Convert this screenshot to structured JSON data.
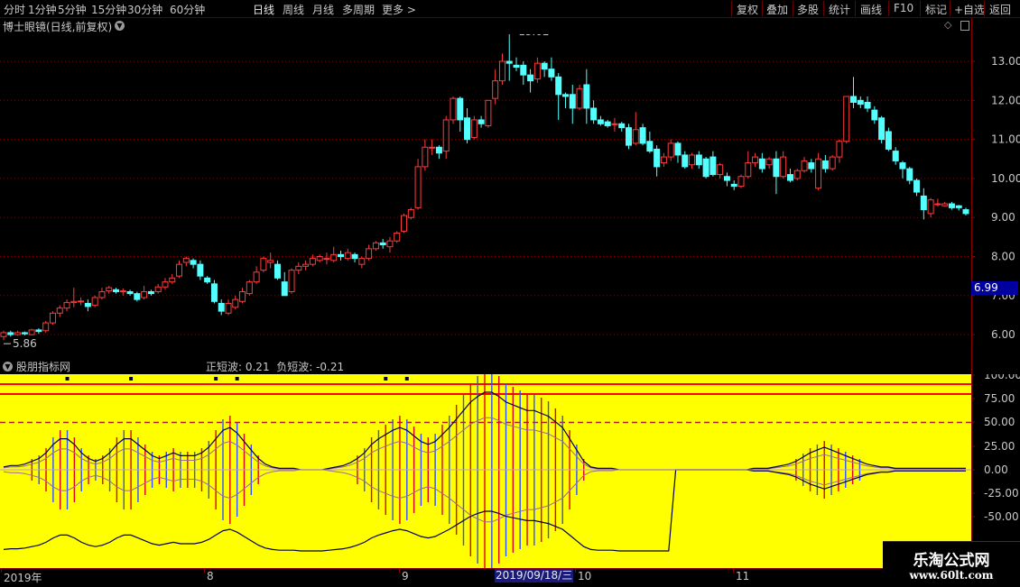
{
  "toolbar": {
    "left_items": [
      "分时",
      "1分钟",
      "5分钟",
      "15分钟",
      "30分钟",
      "60分钟",
      "日线",
      "周线",
      "月线",
      "多周期",
      "更多 >"
    ],
    "active": "日线",
    "right_items": [
      "复权",
      "叠加",
      "多股",
      "统计",
      "画线",
      "F10",
      "标记",
      "+自选",
      "返回"
    ]
  },
  "main_chart": {
    "title": "博士眼镜(日线,前复权)",
    "high_label": "13.62",
    "low_label": "5.86",
    "price_ticks": [
      "13.00",
      "12.00",
      "11.00",
      "10.00",
      "9.00",
      "8.00",
      "7.00",
      "6.00"
    ],
    "current_price": "6.99",
    "colors": {
      "up": "#ff3c3c",
      "down": "#54ffff",
      "grid": "#8b0000"
    },
    "candles": [
      [
        5.95,
        6.05,
        5.86,
        6.1
      ],
      [
        6.05,
        6.0,
        5.95,
        6.1
      ],
      [
        6.0,
        6.05,
        5.97,
        6.1
      ],
      [
        6.05,
        6.02,
        5.98,
        6.08
      ],
      [
        6.0,
        6.12,
        5.98,
        6.15
      ],
      [
        6.12,
        6.08,
        6.02,
        6.16
      ],
      [
        6.1,
        6.3,
        6.05,
        6.35
      ],
      [
        6.3,
        6.55,
        6.25,
        6.6
      ],
      [
        6.55,
        6.68,
        6.45,
        6.75
      ],
      [
        6.68,
        6.82,
        6.6,
        6.9
      ],
      [
        6.82,
        6.85,
        6.7,
        7.2
      ],
      [
        6.85,
        6.86,
        6.75,
        6.95
      ],
      [
        6.8,
        6.72,
        6.6,
        6.9
      ],
      [
        6.75,
        6.95,
        6.7,
        7.0
      ],
      [
        6.95,
        7.1,
        6.9,
        7.2
      ],
      [
        7.12,
        7.2,
        7.05,
        7.25
      ],
      [
        7.15,
        7.1,
        7.05,
        7.2
      ],
      [
        7.1,
        7.12,
        7.0,
        7.18
      ],
      [
        7.1,
        7.05,
        7.0,
        7.15
      ],
      [
        7.05,
        6.9,
        6.85,
        7.1
      ],
      [
        6.95,
        7.1,
        6.9,
        7.25
      ],
      [
        7.1,
        7.05,
        7.0,
        7.15
      ],
      [
        7.1,
        7.22,
        7.05,
        7.3
      ],
      [
        7.22,
        7.35,
        7.15,
        7.45
      ],
      [
        7.35,
        7.45,
        7.3,
        7.55
      ],
      [
        7.5,
        7.8,
        7.45,
        7.9
      ],
      [
        7.85,
        7.95,
        7.75,
        8.0
      ],
      [
        7.9,
        7.8,
        7.7,
        7.95
      ],
      [
        7.8,
        7.5,
        7.4,
        7.9
      ],
      [
        7.45,
        7.35,
        7.3,
        7.5
      ],
      [
        7.3,
        6.85,
        6.8,
        7.4
      ],
      [
        6.8,
        6.6,
        6.5,
        6.9
      ],
      [
        6.55,
        6.8,
        6.5,
        6.9
      ],
      [
        6.7,
        6.9,
        6.65,
        7.0
      ],
      [
        6.85,
        7.1,
        6.8,
        7.2
      ],
      [
        7.05,
        7.35,
        7.0,
        7.4
      ],
      [
        7.35,
        7.6,
        7.3,
        7.75
      ],
      [
        7.65,
        7.95,
        7.6,
        8.0
      ],
      [
        7.85,
        7.9,
        7.7,
        8.1
      ],
      [
        7.8,
        7.45,
        7.4,
        7.9
      ],
      [
        7.35,
        7.0,
        7.0,
        7.6
      ],
      [
        7.1,
        7.65,
        7.05,
        7.7
      ],
      [
        7.65,
        7.75,
        7.55,
        7.85
      ],
      [
        7.75,
        7.8,
        7.65,
        7.9
      ],
      [
        7.8,
        7.95,
        7.75,
        8.05
      ],
      [
        7.9,
        8.0,
        7.85,
        8.05
      ],
      [
        7.95,
        7.95,
        7.8,
        8.1
      ],
      [
        7.9,
        8.05,
        7.85,
        8.25
      ],
      [
        8.05,
        8.0,
        7.9,
        8.15
      ],
      [
        7.95,
        8.1,
        7.9,
        8.2
      ],
      [
        8.05,
        7.95,
        7.85,
        8.1
      ],
      [
        7.8,
        7.95,
        7.7,
        8.0
      ],
      [
        7.95,
        8.2,
        7.9,
        8.3
      ],
      [
        8.2,
        8.35,
        8.15,
        8.4
      ],
      [
        8.35,
        8.3,
        8.2,
        8.45
      ],
      [
        8.25,
        8.4,
        8.1,
        8.5
      ],
      [
        8.4,
        8.6,
        8.35,
        8.65
      ],
      [
        8.65,
        9.05,
        8.6,
        9.1
      ],
      [
        9.0,
        9.2,
        8.95,
        9.25
      ],
      [
        9.25,
        10.3,
        9.2,
        10.5
      ],
      [
        10.3,
        10.8,
        10.2,
        11.0
      ],
      [
        10.8,
        10.8,
        10.6,
        11.0
      ],
      [
        10.8,
        10.65,
        10.5,
        10.85
      ],
      [
        10.7,
        11.5,
        10.5,
        11.6
      ],
      [
        11.5,
        12.05,
        11.4,
        12.1
      ],
      [
        12.05,
        11.5,
        11.2,
        12.1
      ],
      [
        11.55,
        11.0,
        10.9,
        11.8
      ],
      [
        11.05,
        11.5,
        11.0,
        11.6
      ],
      [
        11.5,
        11.4,
        11.3,
        11.6
      ],
      [
        11.35,
        12.0,
        11.3,
        12.0
      ],
      [
        12.05,
        12.5,
        11.9,
        12.8
      ],
      [
        12.5,
        13.0,
        12.4,
        13.2
      ],
      [
        13.0,
        12.95,
        12.5,
        13.62
      ],
      [
        12.9,
        12.85,
        12.75,
        13.1
      ],
      [
        12.9,
        12.65,
        12.4,
        13.0
      ],
      [
        12.65,
        12.5,
        12.2,
        12.8
      ],
      [
        12.55,
        12.95,
        12.45,
        13.1
      ],
      [
        12.95,
        12.8,
        12.6,
        13.0
      ],
      [
        12.8,
        12.6,
        12.5,
        13.1
      ],
      [
        12.6,
        12.15,
        11.5,
        12.7
      ],
      [
        12.15,
        12.1,
        11.8,
        12.2
      ],
      [
        12.15,
        11.8,
        11.4,
        12.4
      ],
      [
        11.8,
        12.3,
        11.75,
        12.4
      ],
      [
        12.4,
        11.8,
        11.4,
        12.8
      ],
      [
        11.8,
        11.5,
        11.4,
        12.0
      ],
      [
        11.5,
        11.4,
        11.35,
        11.6
      ],
      [
        11.45,
        11.35,
        11.3,
        11.5
      ],
      [
        11.4,
        11.4,
        11.2,
        11.55
      ],
      [
        11.4,
        11.3,
        11.2,
        11.45
      ],
      [
        11.3,
        10.85,
        10.75,
        11.4
      ],
      [
        10.9,
        11.25,
        10.85,
        11.7
      ],
      [
        11.3,
        10.9,
        10.85,
        11.4
      ],
      [
        10.95,
        10.7,
        10.65,
        11.2
      ],
      [
        10.75,
        10.3,
        10.05,
        10.85
      ],
      [
        10.4,
        10.55,
        10.3,
        10.65
      ],
      [
        10.55,
        10.9,
        10.45,
        11.0
      ],
      [
        10.9,
        10.6,
        10.4,
        10.95
      ],
      [
        10.6,
        10.3,
        10.25,
        10.7
      ],
      [
        10.35,
        10.6,
        10.25,
        10.65
      ],
      [
        10.6,
        10.35,
        10.25,
        10.7
      ],
      [
        10.5,
        10.05,
        10.0,
        10.55
      ],
      [
        10.55,
        10.1,
        10.05,
        10.7
      ],
      [
        10.1,
        10.35,
        10.0,
        10.4
      ],
      [
        10.05,
        9.95,
        9.8,
        10.15
      ],
      [
        9.85,
        9.8,
        9.7,
        9.95
      ],
      [
        9.8,
        10.05,
        9.75,
        10.1
      ],
      [
        10.05,
        10.4,
        10.0,
        10.7
      ],
      [
        10.4,
        10.55,
        10.3,
        10.65
      ],
      [
        10.5,
        10.25,
        10.15,
        10.65
      ],
      [
        10.35,
        10.5,
        10.25,
        10.55
      ],
      [
        10.5,
        10.05,
        9.6,
        10.7
      ],
      [
        10.05,
        10.55,
        10.0,
        10.7
      ],
      [
        10.1,
        9.95,
        9.9,
        10.25
      ],
      [
        10.0,
        10.2,
        9.95,
        10.25
      ],
      [
        10.2,
        10.45,
        10.15,
        10.55
      ],
      [
        10.4,
        10.25,
        10.15,
        10.5
      ],
      [
        9.75,
        10.5,
        9.7,
        10.65
      ],
      [
        10.45,
        10.25,
        10.15,
        10.6
      ],
      [
        10.25,
        10.55,
        10.2,
        10.6
      ],
      [
        10.55,
        10.95,
        10.4,
        11.0
      ],
      [
        10.95,
        12.1,
        10.9,
        12.1
      ],
      [
        12.1,
        11.95,
        11.8,
        12.6
      ],
      [
        12.0,
        11.9,
        11.8,
        12.1
      ],
      [
        11.95,
        11.8,
        11.7,
        12.1
      ],
      [
        11.75,
        11.5,
        11.4,
        11.85
      ],
      [
        11.55,
        11.0,
        10.9,
        11.6
      ],
      [
        11.2,
        10.75,
        10.7,
        11.3
      ],
      [
        10.7,
        10.45,
        10.35,
        10.8
      ],
      [
        10.4,
        10.25,
        10.0,
        10.45
      ],
      [
        10.25,
        9.95,
        9.85,
        10.3
      ],
      [
        9.95,
        9.65,
        9.55,
        10.0
      ],
      [
        9.55,
        9.2,
        8.95,
        9.75
      ],
      [
        9.1,
        9.45,
        9.0,
        9.5
      ],
      [
        9.35,
        9.35,
        9.28,
        9.48
      ],
      [
        9.3,
        9.35,
        9.28,
        9.4
      ],
      [
        9.35,
        9.25,
        9.2,
        9.4
      ],
      [
        9.3,
        9.25,
        9.18,
        9.32
      ],
      [
        9.2,
        9.1,
        9.05,
        9.25
      ]
    ]
  },
  "indicator": {
    "name": "股朋指标网",
    "legend": "正短波: 0.21  负短波: -0.21",
    "y_ticks": [
      "100.00",
      "75.00",
      "50.00",
      "25.00",
      "0.00",
      "-25.00",
      "-50.00"
    ],
    "colors": {
      "background": "#ffff00",
      "line": "#00004a",
      "ref": "#ff0000",
      "dashed": "#aa2222"
    },
    "osc": [
      2,
      3,
      3,
      4,
      6,
      8,
      12,
      18,
      22,
      22,
      18,
      12,
      8,
      6,
      8,
      12,
      18,
      22,
      22,
      18,
      14,
      10,
      8,
      10,
      12,
      10,
      10,
      10,
      12,
      16,
      22,
      28,
      30,
      26,
      20,
      14,
      8,
      4,
      2,
      1,
      1,
      1,
      0,
      0,
      0,
      0,
      1,
      2,
      3,
      5,
      8,
      12,
      18,
      22,
      25,
      28,
      30,
      28,
      24,
      20,
      18,
      20,
      25,
      30,
      36,
      42,
      48,
      52,
      55,
      55,
      52,
      48,
      46,
      44,
      42,
      42,
      40,
      38,
      34,
      30,
      22,
      14,
      6,
      2,
      1,
      1,
      1,
      0,
      0,
      0,
      0,
      0,
      0,
      0,
      0,
      0,
      0,
      0,
      0,
      0,
      0,
      0,
      0,
      0,
      0,
      0,
      1,
      1,
      1,
      2,
      3,
      4,
      6,
      9,
      12,
      14,
      16,
      14,
      12,
      10,
      8,
      6,
      4,
      3,
      2,
      2,
      1,
      1,
      1,
      1,
      1,
      1,
      1,
      1,
      1,
      1,
      1
    ]
  },
  "x_axis": {
    "labels": [
      "2019年",
      "8",
      "9",
      "10",
      "11"
    ],
    "selected_date": "2019/09/18/三"
  },
  "watermark": {
    "title": "乐淘公式网",
    "url": "www.60lt.com"
  }
}
